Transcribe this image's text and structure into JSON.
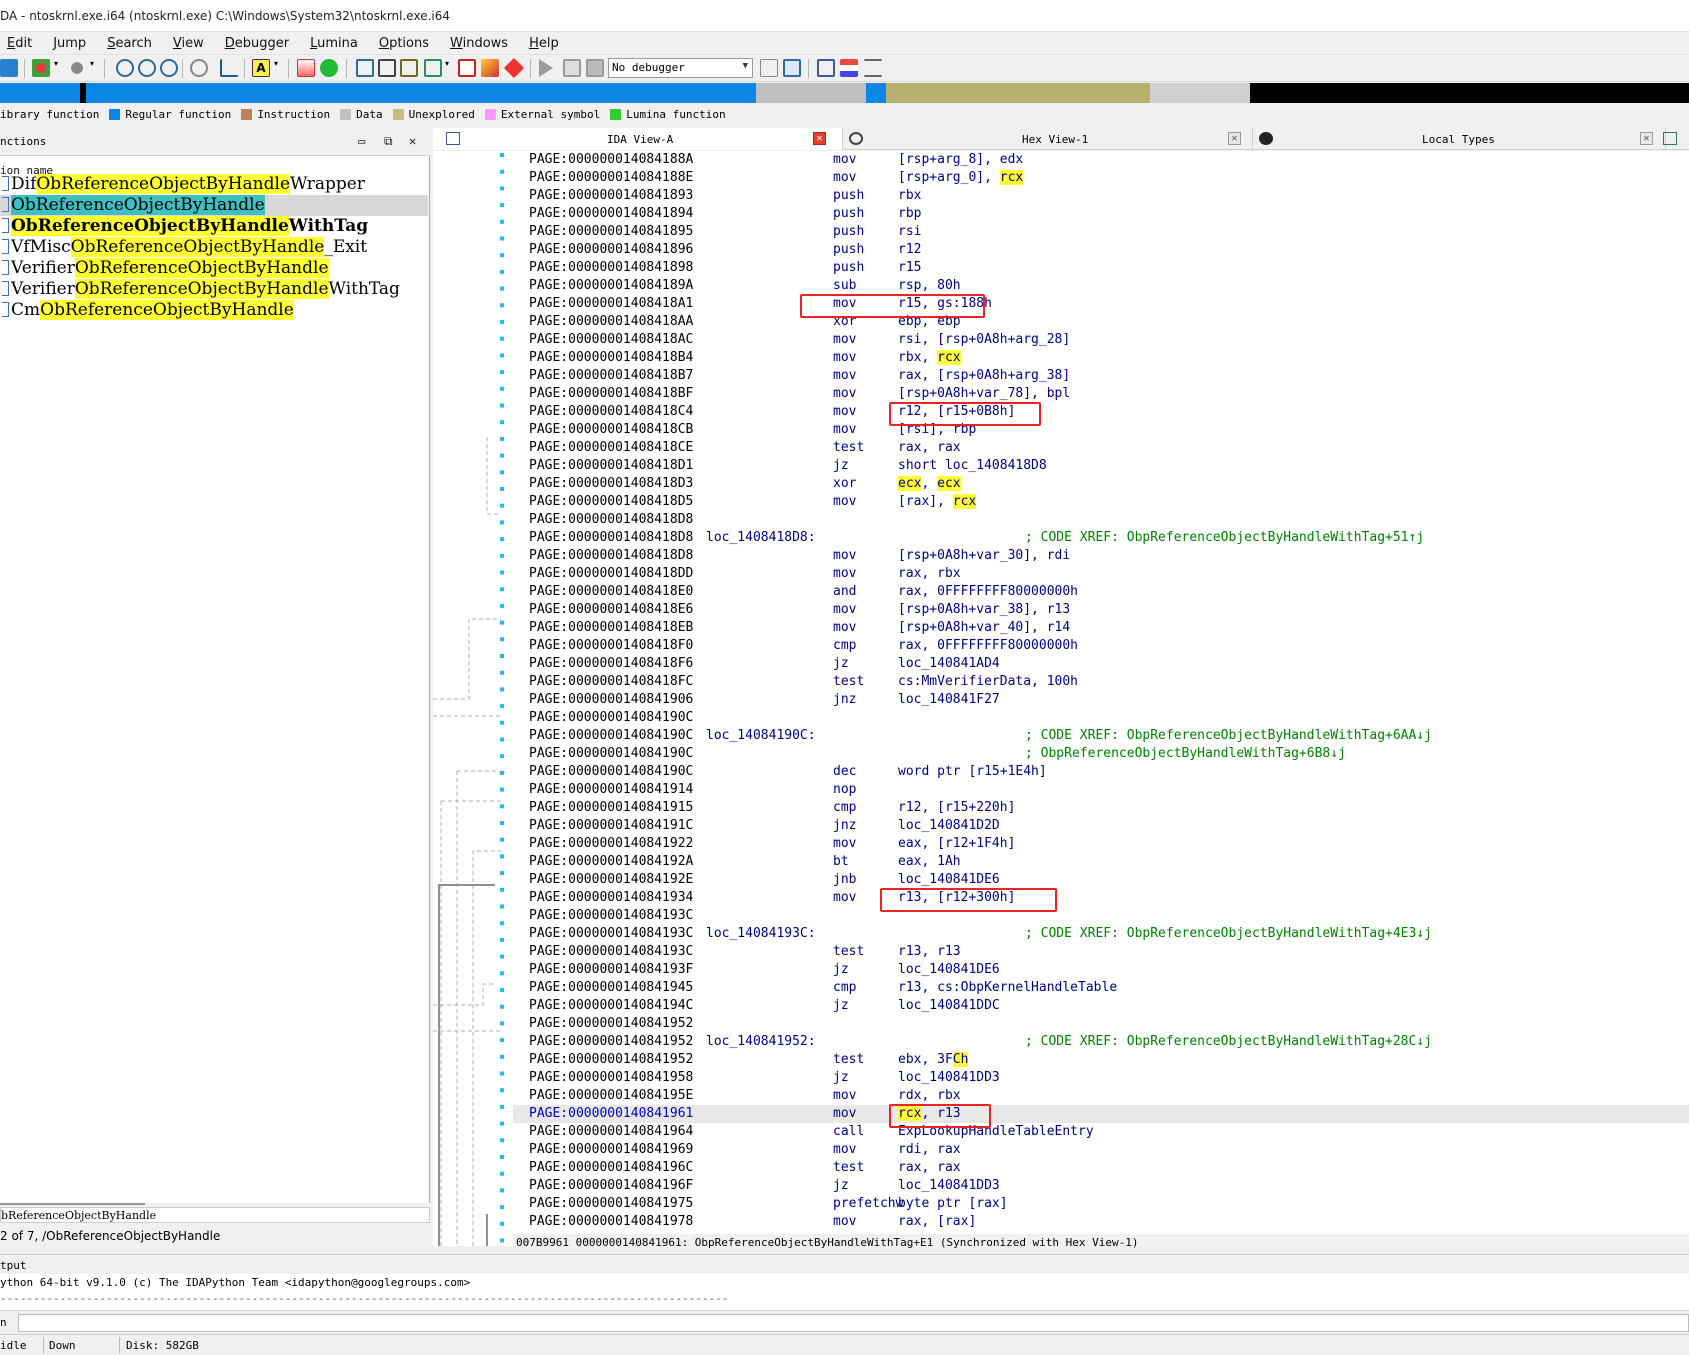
{
  "window": {
    "title": "DA - ntoskrnl.exe.i64 (ntoskrnl.exe) C:\\Windows\\System32\\ntoskrnl.exe.i64"
  },
  "menu": [
    "Edit",
    "Jump",
    "Search",
    "View",
    "Debugger",
    "Lumina",
    "Options",
    "Windows",
    "Help"
  ],
  "toolbar": {
    "debugger_value": "No debugger"
  },
  "legend": [
    {
      "label": "ibrary function",
      "color": "#00ffff"
    },
    {
      "label": "Regular function",
      "color": "#0a86e6"
    },
    {
      "label": "Instruction",
      "color": "#c08060"
    },
    {
      "label": "Data",
      "color": "#c0c0c0"
    },
    {
      "label": "Unexplored",
      "color": "#c0c080"
    },
    {
      "label": "External symbol",
      "color": "#ff99ff"
    },
    {
      "label": "Lumina function",
      "color": "#33cc33"
    }
  ],
  "functions_panel": {
    "title": "nctions",
    "column": "ion name",
    "items": [
      {
        "pre": "Dif",
        "match": "ObReferenceObjectByHandle",
        "post": "Wrapper",
        "bold": false,
        "selected": false
      },
      {
        "pre": "",
        "match": "ObReferenceObjectByHandle",
        "post": "",
        "bold": false,
        "selected": true
      },
      {
        "pre": "",
        "match": "ObReferenceObjectByHandle",
        "post": "WithTag",
        "bold": true,
        "selected": false
      },
      {
        "pre": "VfMisc",
        "match": "ObReferenceObjectByHandle",
        "post": "_Exit",
        "bold": false,
        "selected": false
      },
      {
        "pre": "Verifier",
        "match": "ObReferenceObjectByHandle",
        "post": "",
        "bold": false,
        "selected": false
      },
      {
        "pre": "Verifier",
        "match": "ObReferenceObjectByHandle",
        "post": "WithTag",
        "bold": false,
        "selected": false
      },
      {
        "pre": "Cm",
        "match": "ObReferenceObjectByHandle",
        "post": "",
        "bold": false,
        "selected": false
      }
    ],
    "filter_text": "bReferenceObjectByHandle",
    "status": "2 of 7, /ObReferenceObjectByHandle"
  },
  "tabs": [
    {
      "label": "IDA View-A"
    },
    {
      "label": "Hex View-1"
    },
    {
      "label": "Local Types"
    }
  ],
  "disasm": [
    {
      "addr": "PAGE:000000014084188A",
      "label": "",
      "mn": "mov",
      "op": "[rsp+arg_8], edx",
      "cmt": ""
    },
    {
      "addr": "PAGE:000000014084188E",
      "label": "",
      "mn": "mov",
      "op": "[rsp+arg_0], rcx",
      "cmt": ""
    },
    {
      "addr": "PAGE:0000000140841893",
      "label": "",
      "mn": "push",
      "op": "rbx",
      "cmt": ""
    },
    {
      "addr": "PAGE:0000000140841894",
      "label": "",
      "mn": "push",
      "op": "rbp",
      "cmt": ""
    },
    {
      "addr": "PAGE:0000000140841895",
      "label": "",
      "mn": "push",
      "op": "rsi",
      "cmt": ""
    },
    {
      "addr": "PAGE:0000000140841896",
      "label": "",
      "mn": "push",
      "op": "r12",
      "cmt": ""
    },
    {
      "addr": "PAGE:0000000140841898",
      "label": "",
      "mn": "push",
      "op": "r15",
      "cmt": ""
    },
    {
      "addr": "PAGE:000000014084189A",
      "label": "",
      "mn": "sub",
      "op": "rsp, 80h",
      "cmt": ""
    },
    {
      "addr": "PAGE:00000001408418A1",
      "label": "",
      "mn": "mov",
      "op": "r15, gs:188h",
      "cmt": ""
    },
    {
      "addr": "PAGE:00000001408418AA",
      "label": "",
      "mn": "xor",
      "op": "ebp, ebp",
      "cmt": ""
    },
    {
      "addr": "PAGE:00000001408418AC",
      "label": "",
      "mn": "mov",
      "op": "rsi, [rsp+0A8h+arg_28]",
      "cmt": ""
    },
    {
      "addr": "PAGE:00000001408418B4",
      "label": "",
      "mn": "mov",
      "op": "rbx, rcx",
      "cmt": ""
    },
    {
      "addr": "PAGE:00000001408418B7",
      "label": "",
      "mn": "mov",
      "op": "rax, [rsp+0A8h+arg_38]",
      "cmt": ""
    },
    {
      "addr": "PAGE:00000001408418BF",
      "label": "",
      "mn": "mov",
      "op": "[rsp+0A8h+var_78], bpl",
      "cmt": ""
    },
    {
      "addr": "PAGE:00000001408418C4",
      "label": "",
      "mn": "mov",
      "op": "r12, [r15+0B8h]",
      "cmt": ""
    },
    {
      "addr": "PAGE:00000001408418CB",
      "label": "",
      "mn": "mov",
      "op": "[rsi], rbp",
      "cmt": ""
    },
    {
      "addr": "PAGE:00000001408418CE",
      "label": "",
      "mn": "test",
      "op": "rax, rax",
      "cmt": ""
    },
    {
      "addr": "PAGE:00000001408418D1",
      "label": "",
      "mn": "jz",
      "op": "short loc_1408418D8",
      "cmt": ""
    },
    {
      "addr": "PAGE:00000001408418D3",
      "label": "",
      "mn": "xor",
      "op": "ecx, ecx",
      "cmt": ""
    },
    {
      "addr": "PAGE:00000001408418D5",
      "label": "",
      "mn": "mov",
      "op": "[rax], rcx",
      "cmt": ""
    },
    {
      "addr": "PAGE:00000001408418D8",
      "label": "",
      "mn": "",
      "op": "",
      "cmt": ""
    },
    {
      "addr": "PAGE:00000001408418D8",
      "label": "loc_1408418D8:",
      "mn": "",
      "op": "",
      "cmt": "; CODE XREF: ObpReferenceObjectByHandleWithTag+51↑j"
    },
    {
      "addr": "PAGE:00000001408418D8",
      "label": "",
      "mn": "mov",
      "op": "[rsp+0A8h+var_30], rdi",
      "cmt": ""
    },
    {
      "addr": "PAGE:00000001408418DD",
      "label": "",
      "mn": "mov",
      "op": "rax, rbx",
      "cmt": ""
    },
    {
      "addr": "PAGE:00000001408418E0",
      "label": "",
      "mn": "and",
      "op": "rax, 0FFFFFFFF80000000h",
      "cmt": ""
    },
    {
      "addr": "PAGE:00000001408418E6",
      "label": "",
      "mn": "mov",
      "op": "[rsp+0A8h+var_38], r13",
      "cmt": ""
    },
    {
      "addr": "PAGE:00000001408418EB",
      "label": "",
      "mn": "mov",
      "op": "[rsp+0A8h+var_40], r14",
      "cmt": ""
    },
    {
      "addr": "PAGE:00000001408418F0",
      "label": "",
      "mn": "cmp",
      "op": "rax, 0FFFFFFFF80000000h",
      "cmt": ""
    },
    {
      "addr": "PAGE:00000001408418F6",
      "label": "",
      "mn": "jz",
      "op": "loc_140841AD4",
      "cmt": ""
    },
    {
      "addr": "PAGE:00000001408418FC",
      "label": "",
      "mn": "test",
      "op": "cs:MmVerifierData, 100h",
      "cmt": ""
    },
    {
      "addr": "PAGE:0000000140841906",
      "label": "",
      "mn": "jnz",
      "op": "loc_140841F27",
      "cmt": ""
    },
    {
      "addr": "PAGE:000000014084190C",
      "label": "",
      "mn": "",
      "op": "",
      "cmt": ""
    },
    {
      "addr": "PAGE:000000014084190C",
      "label": "loc_14084190C:",
      "mn": "",
      "op": "",
      "cmt": "; CODE XREF: ObpReferenceObjectByHandleWithTag+6AA↓j"
    },
    {
      "addr": "PAGE:000000014084190C",
      "label": "",
      "mn": "",
      "op": "",
      "cmt": "; ObpReferenceObjectByHandleWithTag+6B8↓j"
    },
    {
      "addr": "PAGE:000000014084190C",
      "label": "",
      "mn": "dec",
      "op": "word ptr [r15+1E4h]",
      "cmt": ""
    },
    {
      "addr": "PAGE:0000000140841914",
      "label": "",
      "mn": "nop",
      "op": "",
      "cmt": ""
    },
    {
      "addr": "PAGE:0000000140841915",
      "label": "",
      "mn": "cmp",
      "op": "r12, [r15+220h]",
      "cmt": ""
    },
    {
      "addr": "PAGE:000000014084191C",
      "label": "",
      "mn": "jnz",
      "op": "loc_140841D2D",
      "cmt": ""
    },
    {
      "addr": "PAGE:0000000140841922",
      "label": "",
      "mn": "mov",
      "op": "eax, [r12+1F4h]",
      "cmt": ""
    },
    {
      "addr": "PAGE:000000014084192A",
      "label": "",
      "mn": "bt",
      "op": "eax, 1Ah",
      "cmt": ""
    },
    {
      "addr": "PAGE:000000014084192E",
      "label": "",
      "mn": "jnb",
      "op": "loc_140841DE6",
      "cmt": ""
    },
    {
      "addr": "PAGE:0000000140841934",
      "label": "",
      "mn": "mov",
      "op": "r13, [r12+300h]",
      "cmt": ""
    },
    {
      "addr": "PAGE:000000014084193C",
      "label": "",
      "mn": "",
      "op": "",
      "cmt": ""
    },
    {
      "addr": "PAGE:000000014084193C",
      "label": "loc_14084193C:",
      "mn": "",
      "op": "",
      "cmt": "; CODE XREF: ObpReferenceObjectByHandleWithTag+4E3↓j"
    },
    {
      "addr": "PAGE:000000014084193C",
      "label": "",
      "mn": "test",
      "op": "r13, r13",
      "cmt": ""
    },
    {
      "addr": "PAGE:000000014084193F",
      "label": "",
      "mn": "jz",
      "op": "loc_140841DE6",
      "cmt": ""
    },
    {
      "addr": "PAGE:0000000140841945",
      "label": "",
      "mn": "cmp",
      "op": "r13, cs:ObpKernelHandleTable",
      "cmt": ""
    },
    {
      "addr": "PAGE:000000014084194C",
      "label": "",
      "mn": "jz",
      "op": "loc_140841DDC",
      "cmt": ""
    },
    {
      "addr": "PAGE:0000000140841952",
      "label": "",
      "mn": "",
      "op": "",
      "cmt": ""
    },
    {
      "addr": "PAGE:0000000140841952",
      "label": "loc_140841952:",
      "mn": "",
      "op": "",
      "cmt": "; CODE XREF: ObpReferenceObjectByHandleWithTag+28C↓j"
    },
    {
      "addr": "PAGE:0000000140841952",
      "label": "",
      "mn": "test",
      "op": "ebx, 3FCh",
      "cmt": ""
    },
    {
      "addr": "PAGE:0000000140841958",
      "label": "",
      "mn": "jz",
      "op": "loc_140841DD3",
      "cmt": ""
    },
    {
      "addr": "PAGE:000000014084195E",
      "label": "",
      "mn": "mov",
      "op": "rdx, rbx",
      "cmt": ""
    },
    {
      "addr": "PAGE:0000000140841961",
      "label": "",
      "mn": "mov",
      "op": "rcx, r13",
      "cmt": ""
    },
    {
      "addr": "PAGE:0000000140841964",
      "label": "",
      "mn": "call",
      "op": "ExpLookupHandleTableEntry",
      "cmt": ""
    },
    {
      "addr": "PAGE:0000000140841969",
      "label": "",
      "mn": "mov",
      "op": "rdi, rax",
      "cmt": ""
    },
    {
      "addr": "PAGE:000000014084196C",
      "label": "",
      "mn": "test",
      "op": "rax, rax",
      "cmt": ""
    },
    {
      "addr": "PAGE:000000014084196F",
      "label": "",
      "mn": "jz",
      "op": "loc_140841DD3",
      "cmt": ""
    },
    {
      "addr": "PAGE:0000000140841975",
      "label": "",
      "mn": "prefetchw",
      "op": "byte ptr [rax]",
      "cmt": ""
    },
    {
      "addr": "PAGE:0000000140841978",
      "label": "",
      "mn": "mov",
      "op": "rax, [rax]",
      "cmt": ""
    }
  ],
  "disasm_status": "007B9961 0000000140841961: ObpReferenceObjectByHandleWithTag+E1 (Synchronized with Hex View-1)",
  "output": {
    "title": "tput",
    "line1": "ython 64-bit v9.1.0 (c) The IDAPython Team <idapython@googlegroups.com>",
    "line2": "--------------------------------------------------------------------------------------------------------------",
    "cmd_label": "n"
  },
  "status_bar": {
    "state": "idle",
    "direction": "Down",
    "disk": "Disk: 582GB"
  }
}
